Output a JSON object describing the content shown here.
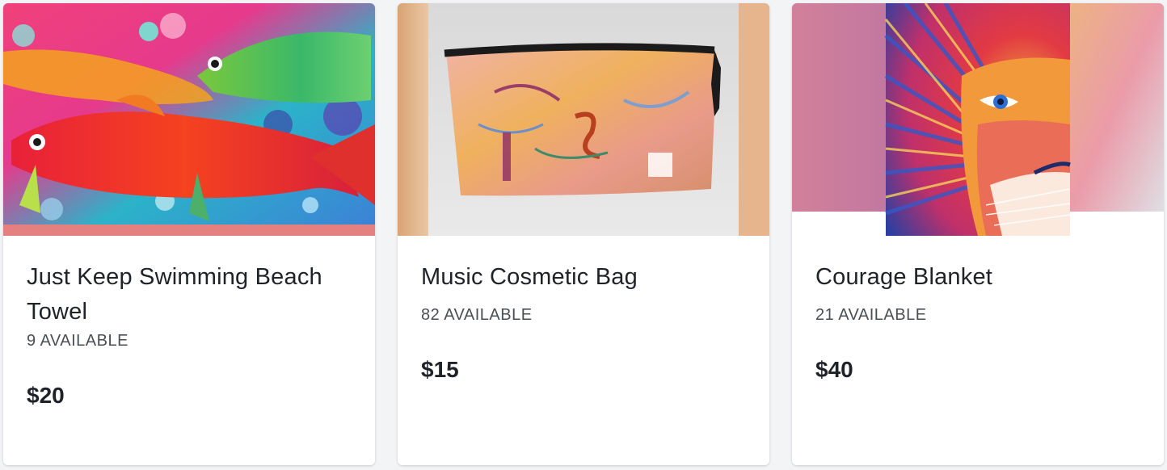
{
  "products": [
    {
      "title": "Just Keep Swimming Beach Towel",
      "availability": "9 AVAILABLE",
      "price": "$20",
      "image": "fish-artwork-image"
    },
    {
      "title": "Music Cosmetic Bag",
      "availability": "82 AVAILABLE",
      "price": "$15",
      "image": "cosmetic-bag-image"
    },
    {
      "title": "Courage Blanket",
      "availability": "21 AVAILABLE",
      "price": "$40",
      "image": "lion-artwork-image"
    }
  ],
  "colors": {
    "page_background": "#f3f4f6",
    "card_background": "#ffffff",
    "title_text": "#1f2328",
    "meta_text": "#4a4f55"
  }
}
